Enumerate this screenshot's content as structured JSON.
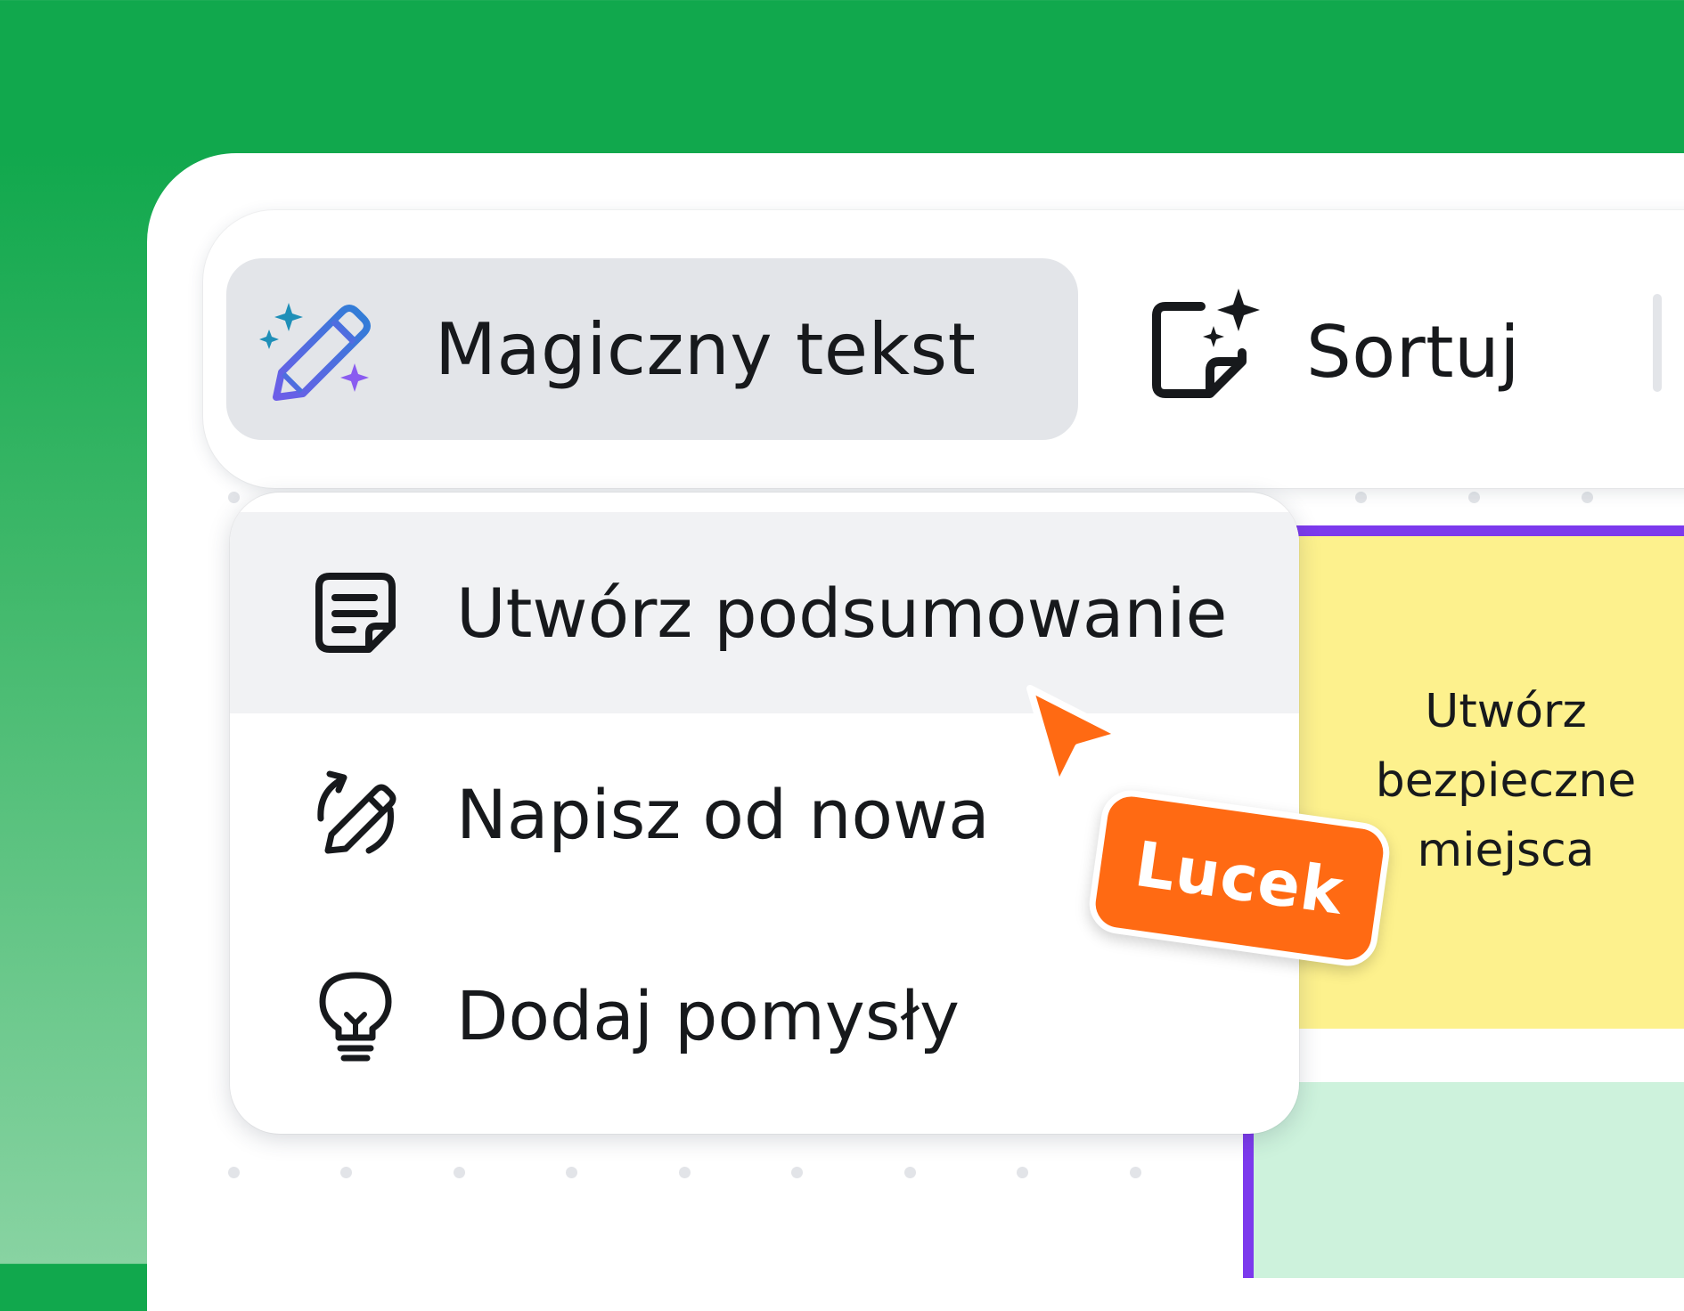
{
  "toolbar": {
    "magic_text_label": "Magiczny tekst",
    "sort_label": "Sortuj"
  },
  "menu": {
    "items": [
      {
        "label": "Utwórz podsumowanie",
        "icon": "summary-note-icon"
      },
      {
        "label": "Napisz od nowa",
        "icon": "rewrite-pencil-icon"
      },
      {
        "label": "Dodaj pomysły",
        "icon": "lightbulb-icon"
      }
    ]
  },
  "sticky_note": {
    "text_line1": "Utwórz",
    "text_line2": "bezpieczne",
    "text_line3": "miejsca"
  },
  "collaborator_cursor": {
    "name": "Lucek",
    "color": "#ff6a13"
  },
  "colors": {
    "brand_green": "#11a84d",
    "accent_purple": "#7c3aed",
    "sticky_yellow": "#fdf18d",
    "sticky_green": "#cdf2dc"
  }
}
